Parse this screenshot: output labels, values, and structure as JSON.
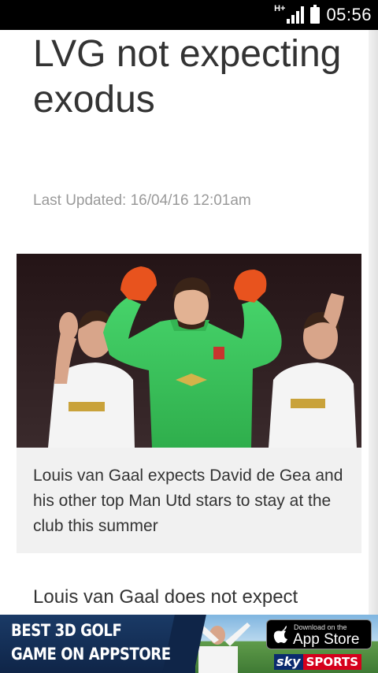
{
  "status_bar": {
    "network_type": "H+",
    "time": "05:56",
    "icons": [
      "signal-icon",
      "battery-icon"
    ]
  },
  "article": {
    "headline": "LVG not expecting exodus",
    "last_updated": "Last Updated: 16/04/16 12:01am",
    "image_caption": "Louis van Gaal expects David de Gea and his other top Man Utd stars to stay at the club this summer",
    "body_first_line": "Louis van Gaal does not expect"
  },
  "ad_banner": {
    "line1": "BEST 3D GOLF",
    "line2": "GAME ON APPSTORE",
    "appstore_small": "Download on the",
    "appstore_big": "App Store",
    "brand_sky": "sky",
    "brand_sports": "SPORTS"
  },
  "colors": {
    "keeper_kit": "#3cc35a",
    "outfield_kit": "#f4f4f4",
    "caption_bg": "#f1f1f1",
    "ad_bg": "#0f2548",
    "sports_red": "#d6001c"
  }
}
